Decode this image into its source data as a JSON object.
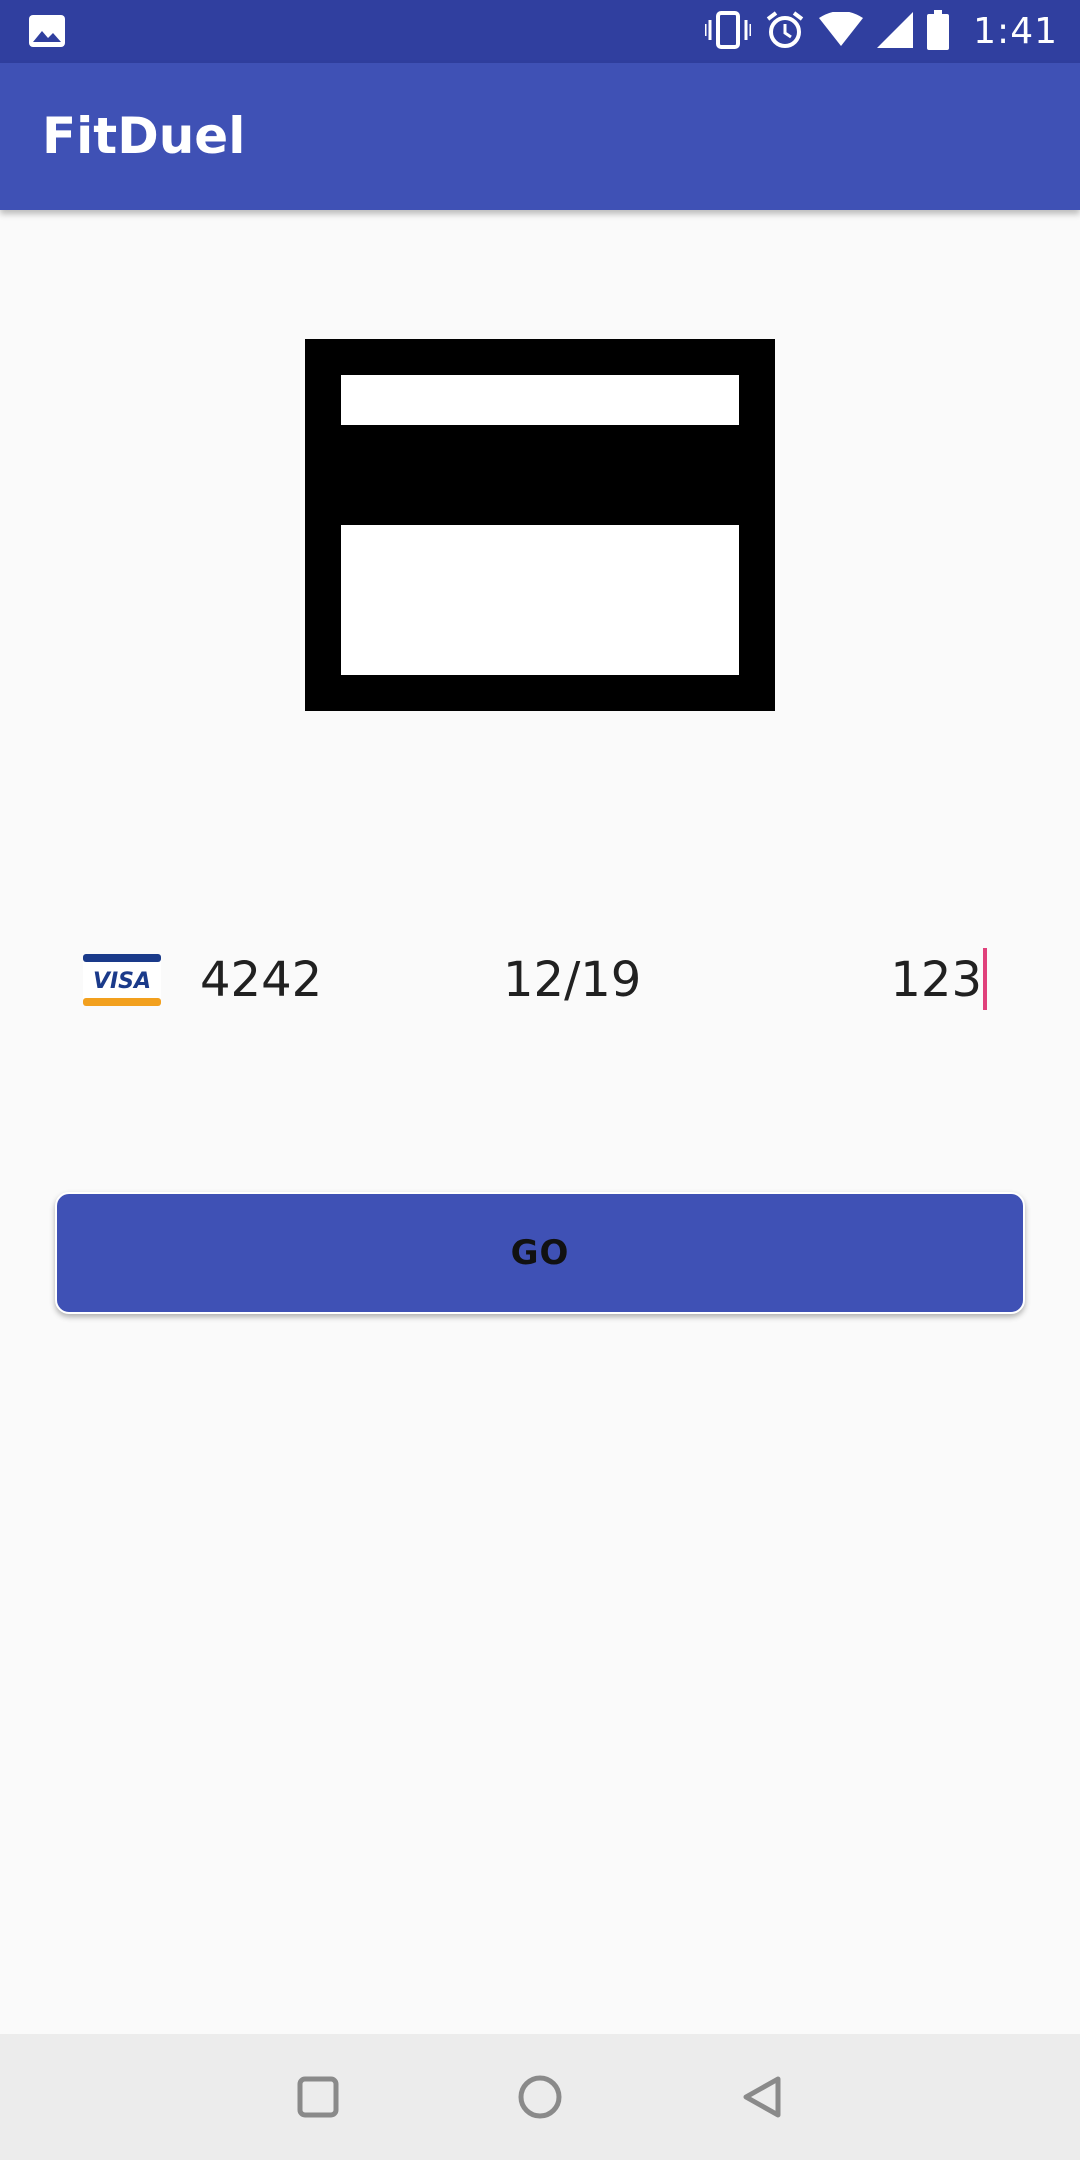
{
  "status_bar": {
    "time": "1:41",
    "icons": [
      "image-icon",
      "vibrate-icon",
      "alarm-icon",
      "wifi-icon",
      "cell-signal-icon",
      "battery-icon"
    ]
  },
  "app_bar": {
    "title": "FitDuel"
  },
  "card_input": {
    "brand": "VISA",
    "number_last4": "4242",
    "expiry": "12/19",
    "cvc": "123"
  },
  "actions": {
    "go_label": "GO"
  },
  "colors": {
    "status_bar": "#303f9f",
    "primary": "#3f51b5",
    "accent_cursor": "#e0407b",
    "background": "#fafafa",
    "nav_bar": "#ececec"
  },
  "nav_bar": {
    "buttons": [
      "recents-icon",
      "home-icon",
      "back-icon"
    ]
  }
}
